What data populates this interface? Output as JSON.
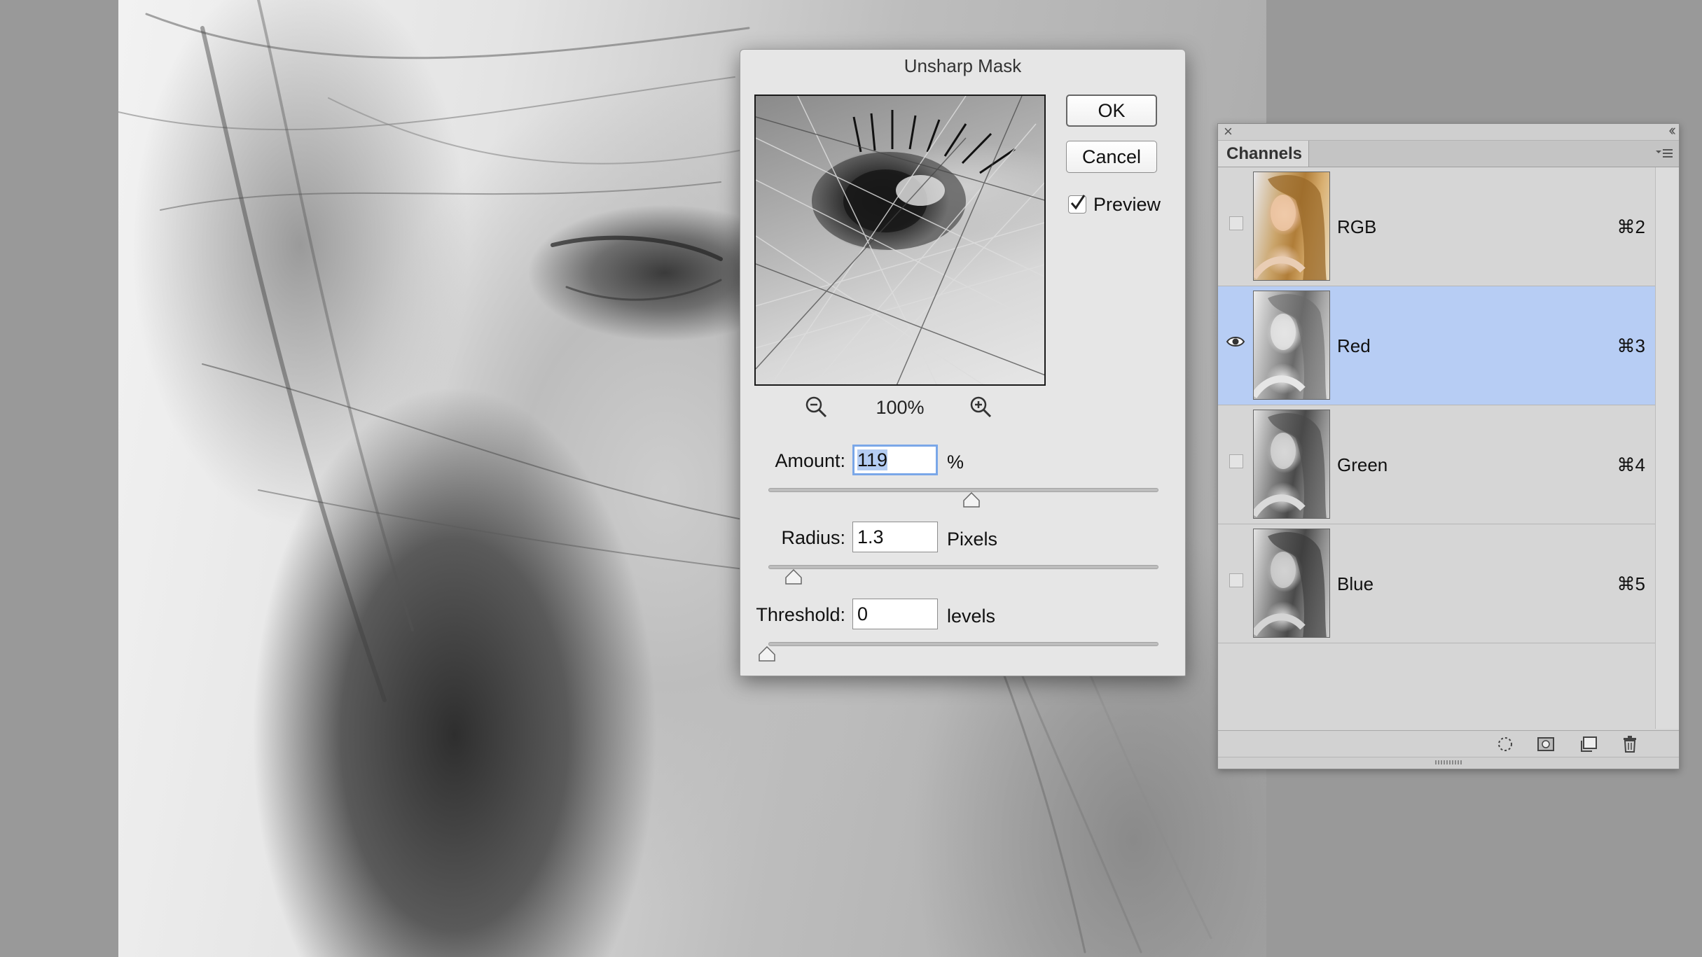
{
  "dialog": {
    "title": "Unsharp Mask",
    "ok_label": "OK",
    "cancel_label": "Cancel",
    "preview_label": "Preview",
    "preview_checked": true,
    "zoom_level": "100%",
    "zoom_out_icon": "zoom-out-icon",
    "zoom_in_icon": "zoom-in-icon",
    "amount": {
      "label": "Amount:",
      "value": "119",
      "unit": "%",
      "slider_fraction": 0.595
    },
    "radius": {
      "label": "Radius:",
      "value": "1.3",
      "unit": "Pixels",
      "slider_fraction": 0.065
    },
    "threshold": {
      "label": "Threshold:",
      "value": "0",
      "unit": "levels",
      "slider_fraction": 0.0
    }
  },
  "channels_panel": {
    "tab_label": "Channels",
    "close_icon": "close-icon",
    "collapse_icon": "double-chevron-icon",
    "menu_icon": "panel-menu-icon",
    "selection_color": "#b7cdf4",
    "channels": [
      {
        "name": "RGB",
        "shortcut": "⌘2",
        "visible": false,
        "selected": false
      },
      {
        "name": "Red",
        "shortcut": "⌘3",
        "visible": true,
        "selected": true
      },
      {
        "name": "Green",
        "shortcut": "⌘4",
        "visible": false,
        "selected": false
      },
      {
        "name": "Blue",
        "shortcut": "⌘5",
        "visible": false,
        "selected": false
      }
    ],
    "footer_icons": [
      "load-selection-icon",
      "save-selection-icon",
      "new-channel-icon",
      "trash-icon"
    ]
  }
}
